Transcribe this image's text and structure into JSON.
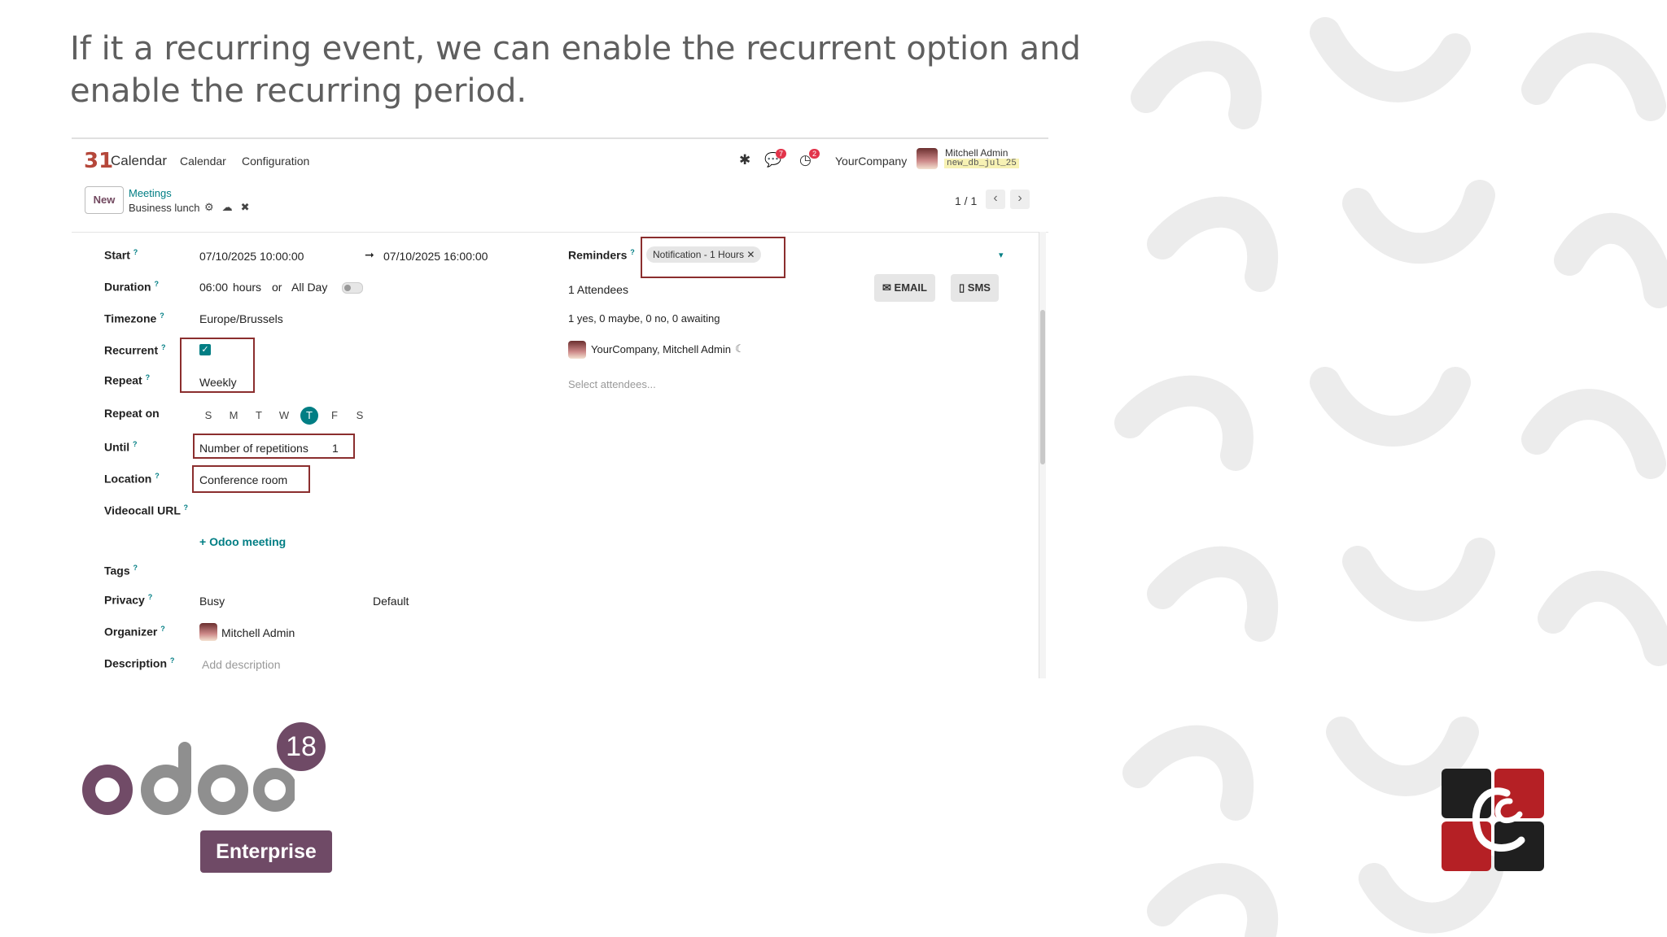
{
  "slide": {
    "title_line1": "If it a recurring event, we can enable the recurrent option and",
    "title_line2": "enable  the recurring period."
  },
  "navbar": {
    "logo": "31",
    "app_name": "Calendar",
    "menu": [
      "Calendar",
      "Configuration"
    ],
    "messages_badge": "7",
    "activities_badge": "2",
    "company": "YourCompany",
    "user_name": "Mitchell Admin",
    "db_name": "new_db_jul_25"
  },
  "control": {
    "new_label": "New",
    "breadcrumb_parent": "Meetings",
    "breadcrumb_current": "Business lunch",
    "pager": "1 / 1"
  },
  "form": {
    "start_label": "Start",
    "start_value": "07/10/2025 10:00:00",
    "end_value": "07/10/2025 16:00:00",
    "duration_label": "Duration",
    "duration_value": "06:00",
    "duration_unit": "hours",
    "or_label": "or",
    "allday_label": "All Day",
    "timezone_label": "Timezone",
    "timezone_value": "Europe/Brussels",
    "recurrent_label": "Recurrent",
    "recurrent_checked": true,
    "repeat_label": "Repeat",
    "repeat_value": "Weekly",
    "repeat_on_label": "Repeat on",
    "days": [
      "S",
      "M",
      "T",
      "W",
      "T",
      "F",
      "S"
    ],
    "active_day_index": 4,
    "until_label": "Until",
    "until_value": "Number of repetitions",
    "until_count": "1",
    "location_label": "Location",
    "location_value": "Conference room",
    "videocall_label": "Videocall URL",
    "odoo_meeting": "Odoo meeting",
    "tags_label": "Tags",
    "privacy_label": "Privacy",
    "privacy_value": "Busy",
    "privacy_default": "Default",
    "organizer_label": "Organizer",
    "organizer_value": "Mitchell Admin",
    "description_label": "Description",
    "description_placeholder": "Add description",
    "reminders_label": "Reminders",
    "reminder_tag": "Notification - 1 Hours",
    "attendees_count": "1 Attendees",
    "email_btn": "EMAIL",
    "sms_btn": "SMS",
    "attendance_summary": "1 yes, 0 maybe, 0 no, 0 awaiting",
    "attendee_name": "YourCompany, Mitchell Admin",
    "select_attendees": "Select attendees..."
  },
  "branding": {
    "version": "18",
    "edition": "Enterprise"
  },
  "colors": {
    "accent": "#017e84",
    "brand": "#6f4a66",
    "highlight": "#8b2e2e"
  }
}
